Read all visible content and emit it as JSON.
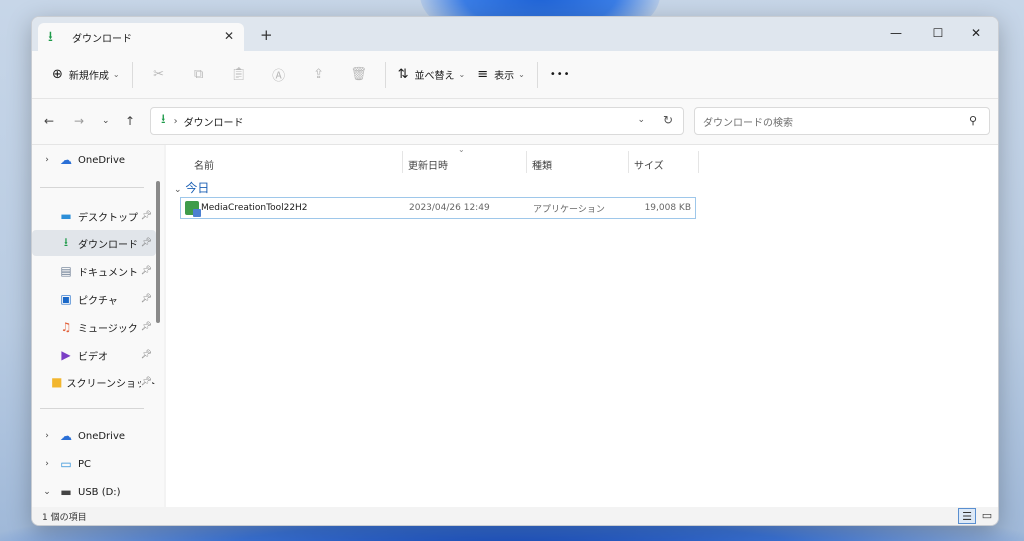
{
  "window": {
    "tab_title": "ダウンロード",
    "tab_close": "✕",
    "new_tab": "+",
    "controls": {
      "minimize": "—",
      "maximize": "☐",
      "close": "✕"
    }
  },
  "toolbar": {
    "new_label": "新規作成",
    "sort_label": "並べ替え",
    "view_label": "表示",
    "more_label": "•••"
  },
  "address": {
    "path": "ダウンロード",
    "search_placeholder": "ダウンロードの検索"
  },
  "sidebar": {
    "top_onedrive": "OneDrive",
    "pinned": [
      {
        "label": "デスクトップ",
        "icon": "desktop-icon"
      },
      {
        "label": "ダウンロード",
        "icon": "download-icon"
      },
      {
        "label": "ドキュメント",
        "icon": "document-icon"
      },
      {
        "label": "ピクチャ",
        "icon": "pictures-icon"
      },
      {
        "label": "ミュージック",
        "icon": "music-icon"
      },
      {
        "label": "ビデオ",
        "icon": "video-icon"
      },
      {
        "label": "スクリーンショット",
        "icon": "folder-icon"
      }
    ],
    "bottom": [
      {
        "label": "OneDrive",
        "icon": "cloud-icon"
      },
      {
        "label": "PC",
        "icon": "pc-icon"
      },
      {
        "label": "USB (D:)",
        "icon": "drive-icon"
      }
    ]
  },
  "columns": {
    "name": "名前",
    "date": "更新日時",
    "type": "種類",
    "size": "サイズ"
  },
  "group": {
    "label": "今日"
  },
  "files": [
    {
      "name": "MediaCreationTool22H2",
      "date": "2023/04/26 12:49",
      "type": "アプリケーション",
      "size": "19,008 KB"
    }
  ],
  "status": {
    "count": "1 個の項目"
  },
  "colors": {
    "accent": "#1e9b4a",
    "selection_border": "#9ec7ea",
    "group_text": "#1a5fb4"
  }
}
